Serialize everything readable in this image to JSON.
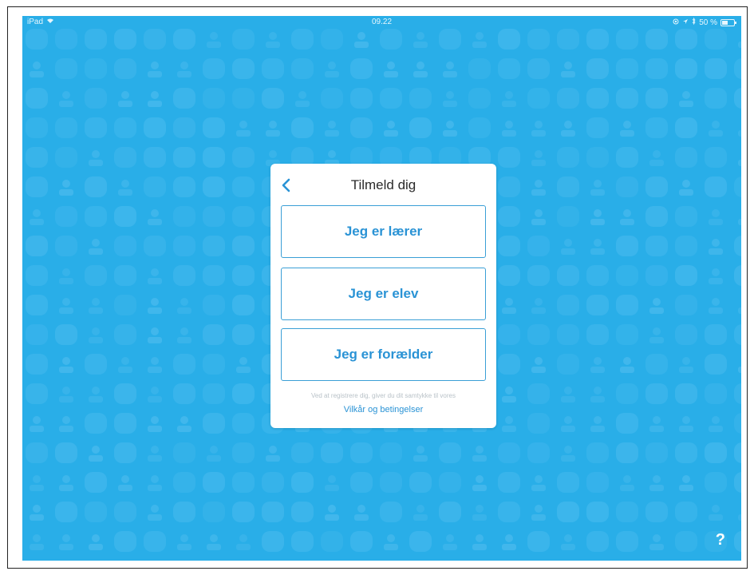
{
  "statusbar": {
    "device": "iPad",
    "time": "09.22",
    "battery_percent": "50 %",
    "battery_level": 0.5
  },
  "dialog": {
    "title": "Tilmeld dig",
    "back_icon": "chevron-left-icon",
    "roles": [
      {
        "label": "Jeg er lærer"
      },
      {
        "label": "Jeg er elev"
      },
      {
        "label": "Jeg er forælder"
      }
    ],
    "consent_text": "Ved at registrere dig, giver du dit samtykke til vores",
    "terms_link": "Vilkår og betingelser"
  },
  "help": {
    "label": "?"
  },
  "colors": {
    "background": "#29aee8",
    "accent": "#2a93d5",
    "card": "#ffffff"
  }
}
